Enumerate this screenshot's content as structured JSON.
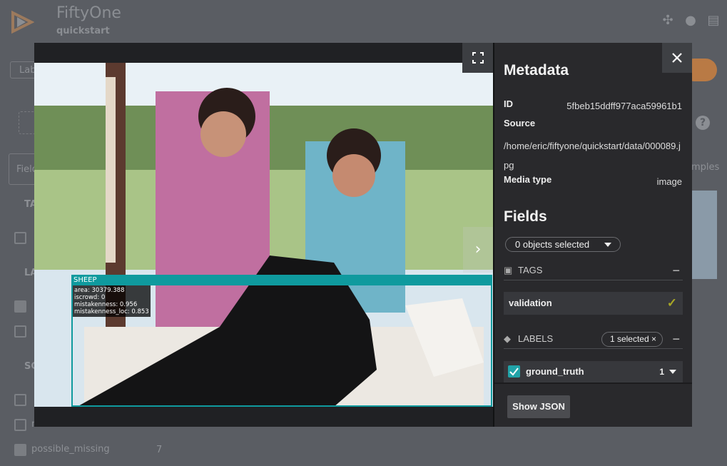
{
  "app": {
    "title": "FiftyOne",
    "dataset": "quickstart",
    "bg_fragments": {
      "labels_tab": "Lab",
      "fields_search": "Field",
      "tags_head": "TA",
      "labels_head": "LA",
      "scalars_head": "SC",
      "samples_count": "mples",
      "mistakenness_field": "mistakenness",
      "possible_missing": "possible_missing",
      "possible_missing_count": "7"
    }
  },
  "viewer": {
    "bbox": {
      "label": "SHEEP",
      "info": [
        "area: 30379.388",
        "iscrowd: 0",
        "mistakenness: 0.956",
        "mistakenness_loc: 0.853"
      ],
      "color": "#0f9a9e"
    }
  },
  "sidebar": {
    "metadata_title": "Metadata",
    "id_key": "ID",
    "id_val": "5fbeb15ddff977aca59961b1",
    "source_key": "Source",
    "source_val": "/home/eric/fiftyone/quickstart/data/000089.jpg",
    "media_key": "Media type",
    "media_val": "image",
    "fields_title": "Fields",
    "objects_selected": "0 objects selected",
    "tags_label": "TAGS",
    "tag_value": "validation",
    "labels_label": "LABELS",
    "labels_selected": "1 selected",
    "gt_name": "ground_truth",
    "gt_count": "1",
    "show_json": "Show JSON"
  },
  "colors": {
    "accent_teal": "#21a3a8",
    "tag_check": "#a7a626",
    "brand_orange": "#b97a45"
  }
}
